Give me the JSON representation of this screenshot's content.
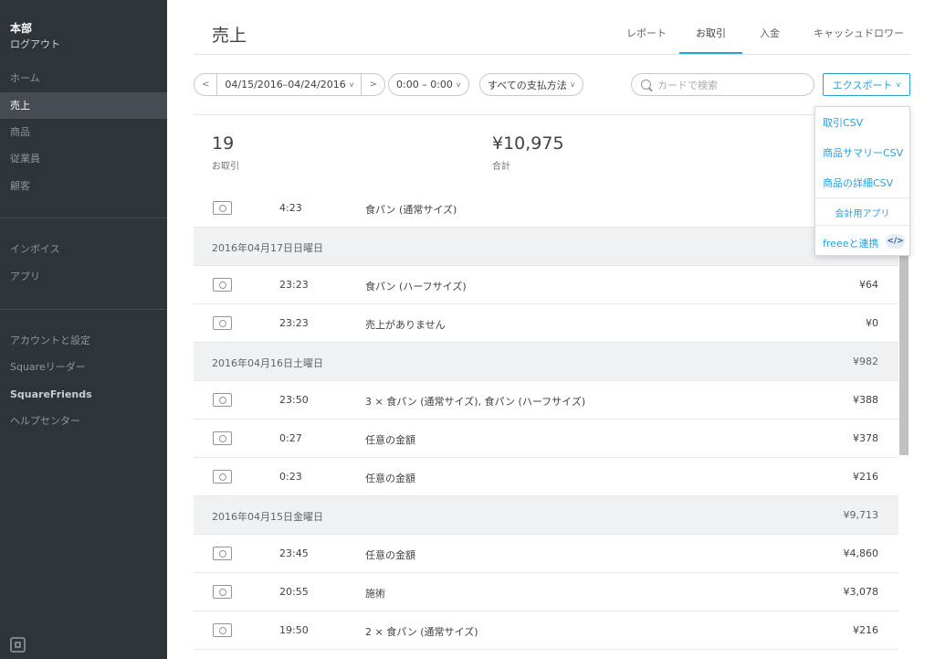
{
  "sidebar": {
    "store_name": "本部",
    "logout": "ログアウト",
    "items": [
      {
        "label": "ホーム"
      },
      {
        "label": "売上"
      },
      {
        "label": "商品"
      },
      {
        "label": "従業員"
      },
      {
        "label": "顧客"
      },
      {
        "label": "インボイス"
      },
      {
        "label": "アプリ"
      },
      {
        "label": "アカウントと設定"
      },
      {
        "label": "Squareリーダー"
      },
      {
        "label": "SquareFriends"
      },
      {
        "label": "ヘルプセンター"
      }
    ]
  },
  "header": {
    "title": "売上",
    "tabs": [
      {
        "label": "レポート"
      },
      {
        "label": "お取引"
      },
      {
        "label": "入金"
      },
      {
        "label": "キャッシュドロワー"
      }
    ]
  },
  "filters": {
    "prev": "<",
    "date_range": "04/15/2016–04/24/2016",
    "next": ">",
    "time_range": "0:00 – 0:00",
    "payment_method": "すべての支払方法",
    "search_placeholder": "カードで検索",
    "export": "エクスポート"
  },
  "summary": {
    "transactions_count": "19",
    "transactions_label": "お取引",
    "total_amount": "¥10,975",
    "total_label": "合計"
  },
  "rows": [
    {
      "type": "txn",
      "time": "4:23",
      "desc": "食パン (通常サイズ)",
      "amount": ""
    },
    {
      "type": "date",
      "label": "2016年04月17日日曜日",
      "amount": ""
    },
    {
      "type": "txn",
      "time": "23:23",
      "desc": "食パン (ハーフサイズ)",
      "amount": "¥64"
    },
    {
      "type": "txn",
      "time": "23:23",
      "desc": "売上がありません",
      "amount": "¥0"
    },
    {
      "type": "date",
      "label": "2016年04月16日土曜日",
      "amount": "¥982"
    },
    {
      "type": "txn",
      "time": "23:50",
      "desc": "3 × 食パン (通常サイズ), 食パン (ハーフサイズ)",
      "amount": "¥388"
    },
    {
      "type": "txn",
      "time": "0:27",
      "desc": "任意の金額",
      "amount": "¥378"
    },
    {
      "type": "txn",
      "time": "0:23",
      "desc": "任意の金額",
      "amount": "¥216"
    },
    {
      "type": "date",
      "label": "2016年04月15日金曜日",
      "amount": "¥9,713"
    },
    {
      "type": "txn",
      "time": "23:45",
      "desc": "任意の金額",
      "amount": "¥4,860"
    },
    {
      "type": "txn",
      "time": "20:55",
      "desc": "施術",
      "amount": "¥3,078"
    },
    {
      "type": "txn",
      "time": "19:50",
      "desc": "2 × 食パン (通常サイズ)",
      "amount": "¥216"
    }
  ],
  "export_menu": {
    "items": [
      {
        "label": "取引CSV"
      },
      {
        "label": "商品サマリーCSV"
      },
      {
        "label": "商品の詳細CSV"
      }
    ],
    "section_label": "会計用アプリ",
    "freee_label": "freeeと連携"
  }
}
